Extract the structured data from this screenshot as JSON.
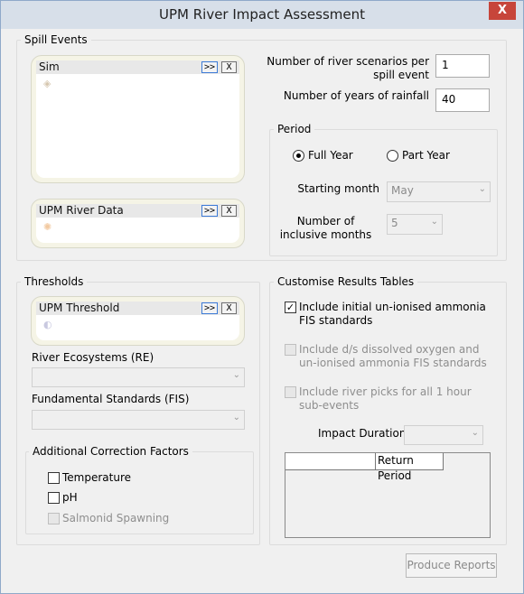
{
  "window": {
    "title": "UPM River Impact Assessment",
    "close_label": "X"
  },
  "spill_events": {
    "label": "Spill Events",
    "sim_box": {
      "title": "Sim",
      "expand_label": ">>",
      "close_label": "X"
    },
    "river_data_box": {
      "title": "UPM River Data",
      "expand_label": ">>",
      "close_label": "X"
    },
    "scenarios_label": "Number of river scenarios per spill event",
    "scenarios_value": "1",
    "years_label": "Number of years of rainfall",
    "years_value": "40",
    "period": {
      "label": "Period",
      "full_year": "Full Year",
      "part_year": "Part Year",
      "selected": "Full Year",
      "starting_month_label": "Starting month",
      "starting_month_value": "May",
      "inclusive_months_label": "Number of inclusive months",
      "inclusive_months_value": "5"
    }
  },
  "thresholds": {
    "label": "Thresholds",
    "upm_box": {
      "title": "UPM Threshold",
      "expand_label": ">>",
      "close_label": "X"
    },
    "re_label": "River Ecosystems (RE)",
    "re_value": "",
    "fis_label": "Fundamental Standards (FIS)",
    "fis_value": "",
    "correction": {
      "label": "Additional Correction Factors",
      "temperature": "Temperature",
      "ph": "pH",
      "salmonid": "Salmonid Spawning"
    }
  },
  "results": {
    "label": "Customise Results Tables",
    "opt1": "Include initial un-ionised ammonia FIS standards",
    "opt2": "Include d/s dissolved oxygen and un-ionised ammonia FIS standards",
    "opt3": "Include river picks for all 1 hour sub-events",
    "impact_label": "Impact Duration",
    "impact_value": "",
    "grid_column": "Return Period"
  },
  "footer": {
    "produce_label": "Produce Reports"
  }
}
